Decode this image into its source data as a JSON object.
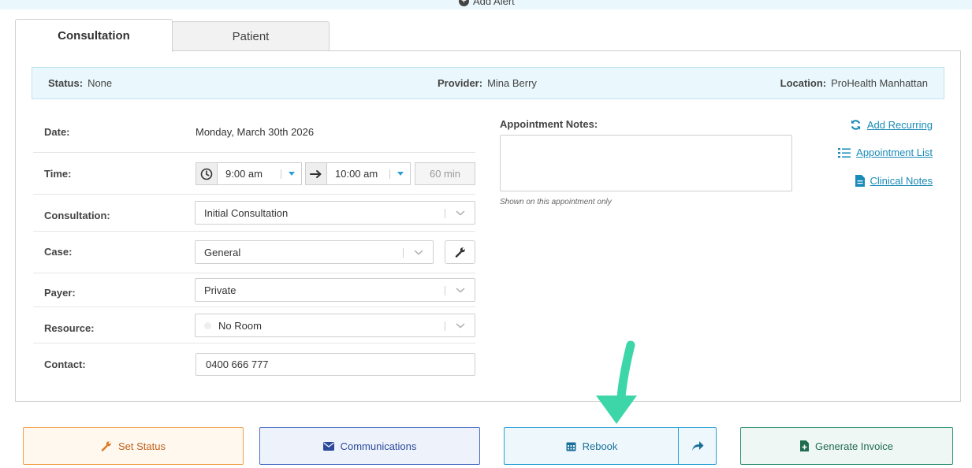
{
  "alert": {
    "add_label": "Add Alert"
  },
  "tabs": [
    {
      "label": "Consultation",
      "active": true
    },
    {
      "label": "Patient",
      "active": false
    }
  ],
  "status_strip": {
    "status_label": "Status:",
    "status_value": "None",
    "provider_label": "Provider:",
    "provider_value": "Mina Berry",
    "location_label": "Location:",
    "location_value": "ProHealth Manhattan"
  },
  "form": {
    "date_label": "Date:",
    "date_value": "Monday, March 30th 2026",
    "time_label": "Time:",
    "start_time": "9:00 am",
    "end_time": "10:00 am",
    "duration": "60 min",
    "consultation_label": "Consultation:",
    "consultation_value": "Initial Consultation",
    "case_label": "Case:",
    "case_value": "General",
    "payer_label": "Payer:",
    "payer_value": "Private",
    "resource_label": "Resource:",
    "resource_value": "No Room",
    "contact_label": "Contact:",
    "contact_value": "0400 666 777"
  },
  "notes": {
    "label": "Appointment Notes:",
    "value": "",
    "help": "Shown on this appointment only"
  },
  "side_links": {
    "add_recurring": "Add Recurring",
    "appointment_list": "Appointment List",
    "clinical_notes": "Clinical Notes"
  },
  "actions": {
    "set_status": "Set Status",
    "communications": "Communications",
    "rebook": "Rebook",
    "generate_invoice": "Generate Invoice"
  },
  "colors": {
    "accent": "#2a9fd6",
    "link": "#1a8bb8",
    "status_orange": "#f0a04a",
    "comm_blue": "#4a6dc4",
    "invoice_green": "#2f8f6f",
    "overlay_arrow": "#3dd6a8"
  },
  "icons": {
    "add_alert": "plus-circle-icon",
    "clock": "clock-icon",
    "arrow": "arrow-right-icon",
    "wrench": "wrench-icon",
    "recurring": "refresh-icon",
    "list": "list-icon",
    "clinical": "file-icon",
    "status": "wrench-icon",
    "comm": "envelope-icon",
    "rebook": "calendar-icon",
    "share": "share-icon",
    "invoice": "file-plus-icon"
  }
}
